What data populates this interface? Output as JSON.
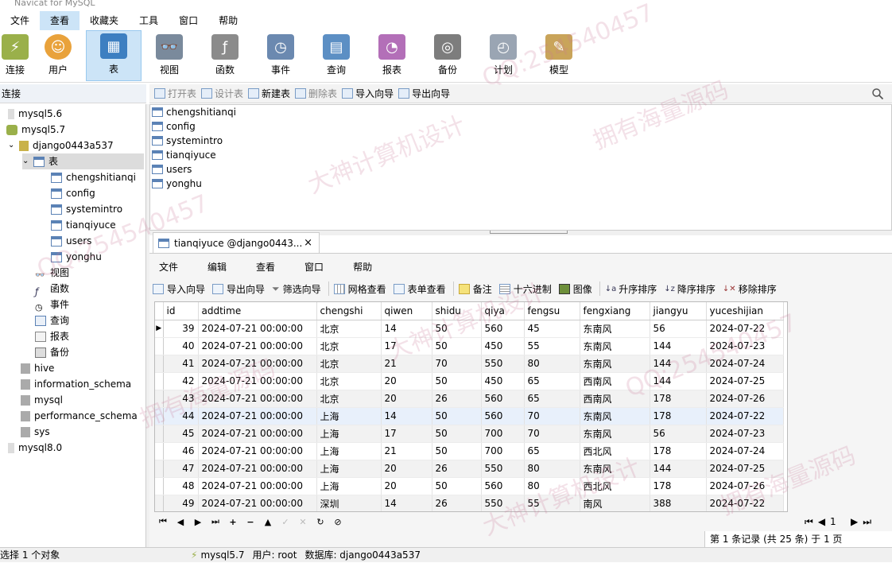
{
  "titlebar": {
    "text": "Navicat for MySQL"
  },
  "menu": [
    "文件",
    "查看",
    "收藏夹",
    "工具",
    "窗口",
    "帮助"
  ],
  "toolbar": [
    "连接",
    "用户",
    "表",
    "视图",
    "函数",
    "事件",
    "查询",
    "报表",
    "备份",
    "计划",
    "模型"
  ],
  "sidebar": {
    "header": "连接",
    "items": [
      {
        "label": "mysql5.6",
        "level": 1
      },
      {
        "label": "mysql5.7",
        "level": 1
      },
      {
        "label": "django0443a537",
        "level": 2
      },
      {
        "label": "表",
        "level": 3
      },
      {
        "label": "chengshitianqi",
        "level": 4
      },
      {
        "label": "config",
        "level": 4
      },
      {
        "label": "systemintro",
        "level": 4
      },
      {
        "label": "tianqiyuce",
        "level": 4
      },
      {
        "label": "users",
        "level": 4
      },
      {
        "label": "yonghu",
        "level": 4
      },
      {
        "label": "视图",
        "level": 3
      },
      {
        "label": "函数",
        "level": 3
      },
      {
        "label": "事件",
        "level": 3
      },
      {
        "label": "查询",
        "level": 3
      },
      {
        "label": "报表",
        "level": 3
      },
      {
        "label": "备份",
        "level": 3
      },
      {
        "label": "hive",
        "level": 2
      },
      {
        "label": "information_schema",
        "level": 2
      },
      {
        "label": "mysql",
        "level": 2
      },
      {
        "label": "performance_schema",
        "level": 2
      },
      {
        "label": "sys",
        "level": 2
      },
      {
        "label": "mysql8.0",
        "level": 1
      }
    ]
  },
  "objbar": [
    "打开表",
    "设计表",
    "新建表",
    "删除表",
    "导入向导",
    "导出向导"
  ],
  "tables": [
    "chengshitianqi",
    "config",
    "systemintro",
    "tianqiyuce",
    "users",
    "yonghu"
  ],
  "doctab": {
    "title": "tianqiyuce @django0443...",
    "close": "×"
  },
  "docmenu": [
    "文件",
    "编辑",
    "查看",
    "窗口",
    "帮助"
  ],
  "gridtoolbar": [
    "导入向导",
    "导出向导",
    "筛选向导",
    "网格查看",
    "表单查看",
    "备注",
    "十六进制",
    "图像",
    "升序排序",
    "降序排序",
    "移除排序"
  ],
  "grid": {
    "columns": [
      "id",
      "addtime",
      "chengshi",
      "qiwen",
      "shidu",
      "qiya",
      "fengsu",
      "fengxiang",
      "jiangyu",
      "yuceshijian"
    ],
    "rows": [
      [
        "39",
        "2024-07-21 00:00:00",
        "北京",
        "14",
        "50",
        "560",
        "45",
        "东南风",
        "56",
        "2024-07-22"
      ],
      [
        "40",
        "2024-07-21 00:00:00",
        "北京",
        "17",
        "50",
        "450",
        "55",
        "东南风",
        "144",
        "2024-07-23"
      ],
      [
        "41",
        "2024-07-21 00:00:00",
        "北京",
        "21",
        "70",
        "550",
        "80",
        "东南风",
        "144",
        "2024-07-24"
      ],
      [
        "42",
        "2024-07-21 00:00:00",
        "北京",
        "20",
        "50",
        "450",
        "65",
        "西南风",
        "144",
        "2024-07-25"
      ],
      [
        "43",
        "2024-07-21 00:00:00",
        "北京",
        "20",
        "26",
        "560",
        "65",
        "西南风",
        "178",
        "2024-07-26"
      ],
      [
        "44",
        "2024-07-21 00:00:00",
        "上海",
        "14",
        "50",
        "560",
        "70",
        "东南风",
        "178",
        "2024-07-22"
      ],
      [
        "45",
        "2024-07-21 00:00:00",
        "上海",
        "17",
        "50",
        "700",
        "70",
        "东南风",
        "56",
        "2024-07-23"
      ],
      [
        "46",
        "2024-07-21 00:00:00",
        "上海",
        "21",
        "50",
        "700",
        "65",
        "西北风",
        "178",
        "2024-07-24"
      ],
      [
        "47",
        "2024-07-21 00:00:00",
        "上海",
        "20",
        "26",
        "550",
        "80",
        "东南风",
        "144",
        "2024-07-25"
      ],
      [
        "48",
        "2024-07-21 00:00:00",
        "上海",
        "20",
        "50",
        "560",
        "80",
        "西北风",
        "178",
        "2024-07-26"
      ],
      [
        "49",
        "2024-07-21 00:00:00",
        "深圳",
        "14",
        "26",
        "550",
        "55",
        "南风",
        "388",
        "2024-07-22"
      ]
    ]
  },
  "navbar": [
    "⏮",
    "◀",
    "▶",
    "⏭",
    "+",
    "−",
    "▲",
    "✓",
    "✕",
    "↻",
    "⊘"
  ],
  "pager": {
    "page": "1"
  },
  "recinfo": "第 1 条记录 (共 25 条) 于 1 页",
  "status": {
    "selection": "选择 1 个对象",
    "conn": "mysql5.7",
    "user": "用户: root",
    "db": "数据库: django0443a537"
  },
  "watermarks": [
    "大神计算机设计",
    "QQ:254540457",
    "拥有海量源码"
  ]
}
